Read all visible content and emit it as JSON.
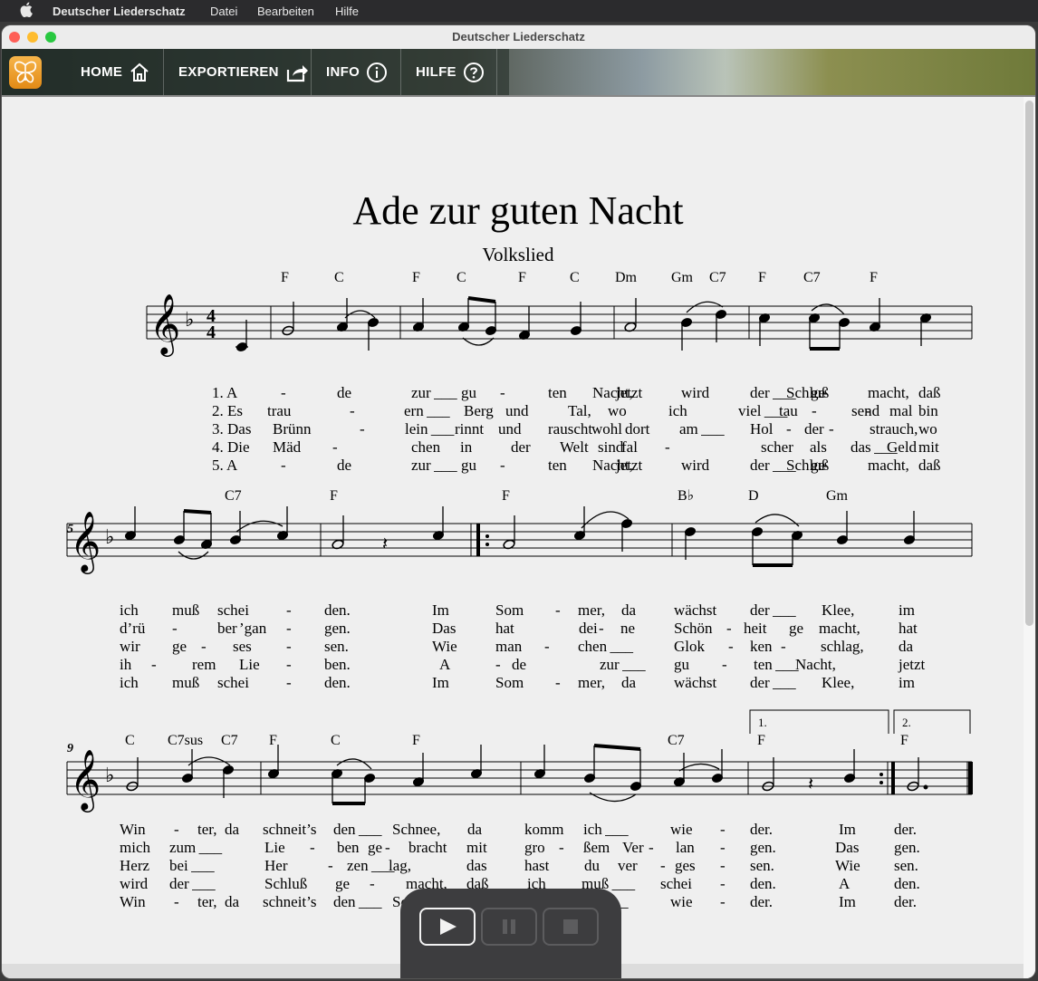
{
  "menubar": {
    "app": "Deutscher Liederschatz",
    "items": [
      "Datei",
      "Bearbeiten",
      "Hilfe"
    ]
  },
  "window": {
    "title": "Deutscher Liederschatz"
  },
  "toolbar": {
    "home": "HOME",
    "export": "EXPORTIEREN",
    "info": "INFO",
    "help": "HILFE"
  },
  "song": {
    "title": "Ade zur guten Nacht",
    "subtitle": "Volkslied",
    "key": "F-Dur",
    "time": "4/4",
    "measure_numbers": [
      "5",
      "9"
    ],
    "volta": [
      "1.",
      "2."
    ],
    "chords": {
      "sys1": [
        "F",
        "C",
        "F",
        "C",
        "F",
        "C",
        "Dm",
        "Gm",
        "C7",
        "F",
        "C7",
        "F"
      ],
      "sys2": [
        "C7",
        "F",
        "F",
        "B♭",
        "D",
        "Gm"
      ],
      "sys3": [
        "C",
        "C7sus",
        "C7",
        "F",
        "C",
        "F",
        "C7",
        "F",
        "F"
      ]
    },
    "lyrics": {
      "sys1": [
        [
          "1. A",
          "-",
          "de",
          "zur__",
          "gu",
          "-",
          "ten",
          "Nacht,",
          "jetzt",
          "wird",
          "der__",
          "Schluß",
          "ge",
          "-",
          "macht,",
          "daß"
        ],
        [
          "2. Es",
          "trau",
          "-",
          "ern__",
          "Berg",
          "und",
          "Tal,",
          "wo",
          "ich",
          "viel__",
          "tau",
          "-",
          "send",
          "-",
          "mal",
          "bin"
        ],
        [
          "3. Das",
          "Brünn",
          "-",
          "lein__",
          "rinnt",
          "und",
          "rauscht",
          "wohl",
          "dort",
          "am__",
          "Hol",
          "-",
          "der",
          "-",
          "strauch,",
          "wo"
        ],
        [
          "4. Die",
          "Mäd",
          "-",
          "chen",
          "in",
          "der",
          "Welt",
          "sind",
          "fal",
          "-",
          "scher",
          "als",
          "das__",
          "Geld",
          "mit"
        ],
        [
          "5. A",
          "-",
          "de",
          "zur__",
          "gu",
          "-",
          "ten",
          "Nacht,",
          "jetzt",
          "wird",
          "der__",
          "Schluß",
          "ge",
          "-",
          "macht,",
          "daß"
        ]
      ],
      "sys2": [
        [
          "ich",
          "muß",
          "schei",
          "-",
          "den.",
          "Im",
          "Som",
          "-",
          "mer,",
          "da",
          "wächst",
          "der__",
          "Klee,",
          "im"
        ],
        [
          "d’rü",
          "-",
          "ber",
          "’gan",
          "-",
          "gen.",
          "Das",
          "hat",
          "dei",
          "-",
          "ne",
          "Schön",
          "-",
          "heit",
          "ge",
          "macht,",
          "hat"
        ],
        [
          "wir",
          "ge",
          "-",
          "ses",
          "-",
          "sen.",
          "Wie",
          "man",
          "-",
          "chen__",
          "Glok",
          "-",
          "ken",
          "-",
          "schlag,",
          "da"
        ],
        [
          "ih",
          "-",
          "rem",
          "Lie",
          "-",
          "ben.",
          "A",
          "-",
          "de",
          "zur__",
          "gu",
          "-",
          "ten__",
          "Nacht,",
          "jetzt"
        ],
        [
          "ich",
          "muß",
          "schei",
          "-",
          "den.",
          "Im",
          "Som",
          "-",
          "mer,",
          "da",
          "wächst",
          "der__",
          "Klee,",
          "im"
        ]
      ],
      "sys3": [
        [
          "Win",
          "-",
          "ter,",
          "da",
          "schneit’s",
          "den__",
          "Schnee,",
          "da",
          "komm",
          "ich__",
          "wie",
          "-",
          "der.",
          "Im",
          "der."
        ],
        [
          "mich",
          "zum__",
          "Lie",
          "-",
          "ben",
          "ge",
          "-",
          "bracht",
          "mit",
          "gro",
          "-",
          "ßem",
          "Ver",
          "-",
          "lan",
          "-",
          "gen.",
          "Das",
          "gen."
        ],
        [
          "Herz",
          "bei__",
          "Her",
          "-",
          "zen__",
          "lag,",
          "das",
          "hast",
          "du",
          "ver",
          "-",
          "ges",
          "-",
          "sen.",
          "Wie",
          "sen."
        ],
        [
          "wird",
          "der__",
          "Schluß",
          "ge",
          "-",
          "macht,",
          "daß",
          "ich",
          "muß__",
          "schei",
          "-",
          "den.",
          "A",
          "den."
        ],
        [
          "Win",
          "-",
          "ter,",
          "da",
          "schneit’s",
          "den__",
          "Schnee,",
          "da",
          "komm",
          "ich__",
          "wie",
          "-",
          "der.",
          "Im",
          "der."
        ]
      ]
    }
  },
  "lyric_lines": {
    "sys1": [
      "1. A  -  de  zur__  gu  -  ten  Nacht, jetzt  wird  der__  Schluß ge - macht, daß",
      "2. Es  trau - ern__  Berg  und  Tal,  wo  ich  viel__  tau - send - mal  bin",
      "3. Das  Brünn - lein__  rinnt  und  rauscht wohl  dort  am__  Hol - der - strauch, wo",
      "4. Die  Mäd - chen  in  der  Welt  sind  fal - scher  als  das__ Geld  mit",
      "5. A  -  de  zur__  gu  -  ten  Nacht, jetzt  wird  der__  Schluß ge - macht, daß"
    ]
  },
  "player": {
    "play": "play-icon",
    "pause": "pause-icon",
    "stop": "stop-icon"
  },
  "colors": {
    "accent": "#f2a42f",
    "menubar": "#2b2b2d",
    "player": "#3d3d3f",
    "paper": "#efefef"
  }
}
